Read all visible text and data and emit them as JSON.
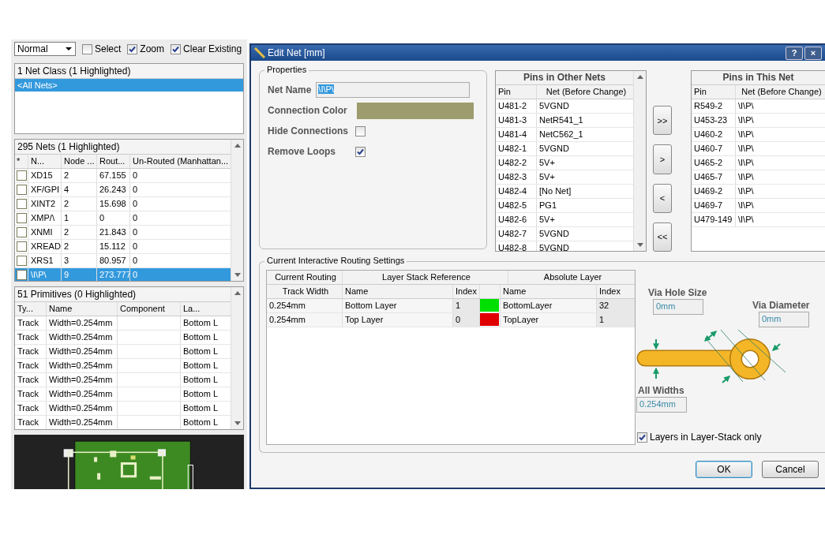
{
  "panel": {
    "mode": "Normal",
    "checkboxes": [
      {
        "label": "Select",
        "checked": false
      },
      {
        "label": "Zoom",
        "checked": true
      },
      {
        "label": "Clear Existing",
        "checked": true
      }
    ],
    "net_classes": {
      "header": "1 Net Class (1 Highlighted)",
      "items": [
        {
          "label": "<All Nets>",
          "selected": true
        }
      ]
    },
    "nets": {
      "header": "295 Nets (1 Highlighted)",
      "swatch_column": "*",
      "columns": [
        "N...",
        "Node ...",
        "Rout...",
        "Un-Routed (Manhattan..."
      ],
      "rows": [
        {
          "cells": [
            "XD15",
            "2",
            "67.155",
            "0"
          ],
          "selected": false
        },
        {
          "cells": [
            "XF/GPI",
            "4",
            "26.243",
            "0"
          ],
          "selected": false
        },
        {
          "cells": [
            "XINT2",
            "2",
            "15.698",
            "0"
          ],
          "selected": false
        },
        {
          "cells": [
            "XMP/\\",
            "1",
            "0",
            "0"
          ],
          "selected": false
        },
        {
          "cells": [
            "XNMI",
            "2",
            "21.843",
            "0"
          ],
          "selected": false
        },
        {
          "cells": [
            "XREAD",
            "2",
            "15.112",
            "0"
          ],
          "selected": false
        },
        {
          "cells": [
            "XRS1",
            "3",
            "80.957",
            "0"
          ],
          "selected": false
        },
        {
          "cells": [
            "\\I\\P\\",
            "9",
            "273.777",
            "0"
          ],
          "selected": true
        }
      ]
    },
    "primitives": {
      "header": "51 Primitives (0 Highlighted)",
      "columns": [
        "Ty...",
        "Name",
        "Component",
        "La..."
      ],
      "rows": [
        {
          "type": "Track",
          "name": "Width=0.254mm",
          "layer": "Bottom L"
        },
        {
          "type": "Track",
          "name": "Width=0.254mm",
          "layer": "Bottom L"
        },
        {
          "type": "Track",
          "name": "Width=0.254mm",
          "layer": "Bottom L"
        },
        {
          "type": "Track",
          "name": "Width=0.254mm",
          "layer": "Bottom L"
        },
        {
          "type": "Track",
          "name": "Width=0.254mm",
          "layer": "Bottom L"
        },
        {
          "type": "Track",
          "name": "Width=0.254mm",
          "layer": "Bottom L"
        },
        {
          "type": "Track",
          "name": "Width=0.254mm",
          "layer": "Bottom L"
        },
        {
          "type": "Track",
          "name": "Width=0.254mm",
          "layer": "Bottom L"
        }
      ]
    }
  },
  "dialog": {
    "title": "Edit Net [mm]",
    "title_buttons": [
      "?",
      "×"
    ],
    "properties": {
      "legend": "Properties",
      "net_name_label": "Net Name",
      "net_name": "\\I\\P\\",
      "color_label": "Connection Color",
      "color": "#9c9c6e",
      "options": [
        {
          "label": "Hide Connections",
          "checked": false
        },
        {
          "label": "Remove Loops",
          "checked": true
        }
      ]
    },
    "pins_other": {
      "title": "Pins in Other Nets",
      "columns": [
        "Pin",
        "Net (Before Change)"
      ],
      "rows": [
        [
          "U481-2",
          "5VGND"
        ],
        [
          "U481-3",
          "NetR541_1"
        ],
        [
          "U481-4",
          "NetC562_1"
        ],
        [
          "U482-1",
          "5VGND"
        ],
        [
          "U482-2",
          "5V+"
        ],
        [
          "U482-3",
          "5V+"
        ],
        [
          "U482-4",
          "[No Net]"
        ],
        [
          "U482-5",
          "PG1"
        ],
        [
          "U482-6",
          "5V+"
        ],
        [
          "U482-7",
          "5VGND"
        ],
        [
          "U482-8",
          "5VGND"
        ]
      ]
    },
    "transfer_buttons": [
      ">>",
      ">",
      "<",
      "<<"
    ],
    "pins_this": {
      "title": "Pins in This Net",
      "columns": [
        "Pin",
        "Net (Before Change)"
      ],
      "rows": [
        [
          "R549-2",
          "\\I\\P\\"
        ],
        [
          "U453-23",
          "\\I\\P\\"
        ],
        [
          "U460-2",
          "\\I\\P\\"
        ],
        [
          "U460-7",
          "\\I\\P\\"
        ],
        [
          "U465-2",
          "\\I\\P\\"
        ],
        [
          "U465-7",
          "\\I\\P\\"
        ],
        [
          "U469-2",
          "\\I\\P\\"
        ],
        [
          "U469-7",
          "\\I\\P\\"
        ],
        [
          "U479-149",
          "\\I\\P\\"
        ]
      ]
    },
    "routing": {
      "legend": "Current Interactive Routing Settings",
      "groups": [
        "Current Routing",
        "Layer Stack Reference",
        "Absolute Layer"
      ],
      "columns": [
        "Track Width",
        "Name",
        "Index",
        "Name",
        "Index"
      ],
      "rows": [
        {
          "width": "0.254mm",
          "stack_name": "Bottom Layer",
          "stack_index": "1",
          "color": "#00e000",
          "layer": "BottomLayer",
          "layer_index": "32"
        },
        {
          "width": "0.254mm",
          "stack_name": "Top Layer",
          "stack_index": "0",
          "color": "#e00000",
          "layer": "TopLayer",
          "layer_index": "1"
        }
      ],
      "via_hole_label": "Via Hole Size",
      "via_hole": "0mm",
      "via_diameter_label": "Via Diameter",
      "via_diameter": "0mm",
      "widths_label": "All Widths",
      "widths": "0.254mm",
      "layers_only": {
        "label": "Layers in Layer-Stack only",
        "checked": true
      }
    },
    "buttons": [
      "OK",
      "Cancel"
    ]
  }
}
